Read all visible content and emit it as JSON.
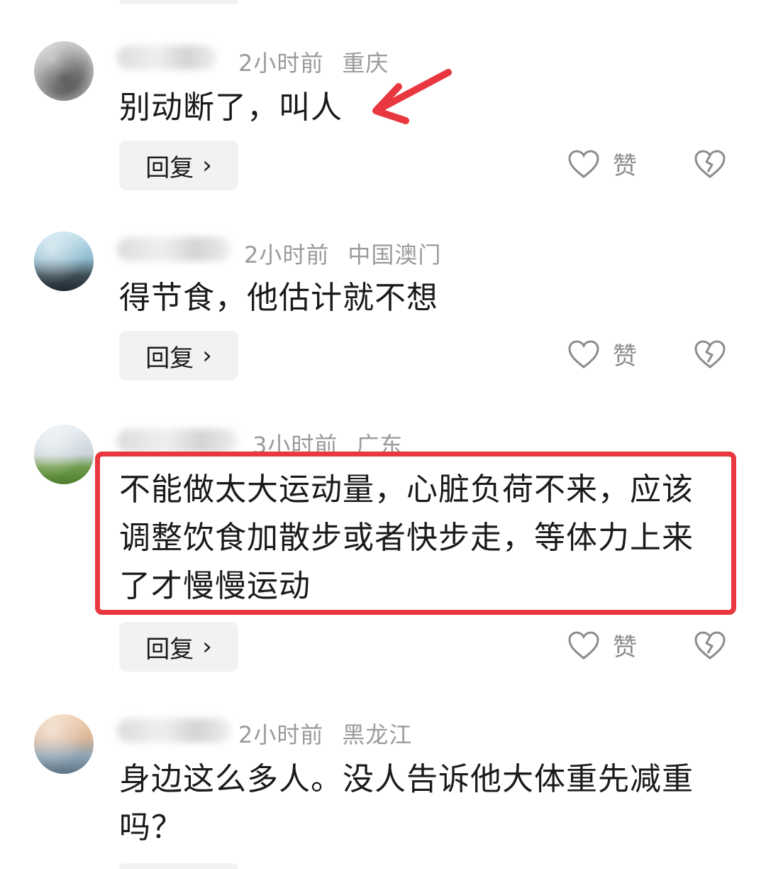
{
  "comments": [
    {
      "time": "2小时前",
      "location": "重庆",
      "lines": [
        "别动断了，叫人"
      ],
      "reply_label": "回复",
      "like_label": "赞"
    },
    {
      "time": "2小时前",
      "location": "中国澳门",
      "lines": [
        "得节食，他估计就不想"
      ],
      "reply_label": "回复",
      "like_label": "赞"
    },
    {
      "time": "3小时前",
      "location": "广东",
      "lines": [
        "不能做太大运动量，心脏负荷不来，应该",
        "调整饮食加散步或者快步走，等体力上来",
        "了才慢慢运动"
      ],
      "reply_label": "回复",
      "like_label": "赞"
    },
    {
      "time": "2小时前",
      "location": "黑龙江",
      "lines": [
        "身边这么多人。没人告诉他大体重先减重",
        "吗？"
      ]
    }
  ],
  "colors": {
    "annotation_red": "#e8373e",
    "meta_gray": "#9a9a9a",
    "button_bg": "#f1f2f4"
  },
  "icons": {
    "like": "heart-outline-icon",
    "dislike": "broken-heart-icon",
    "reply_chevron": "chevron-right-icon"
  }
}
